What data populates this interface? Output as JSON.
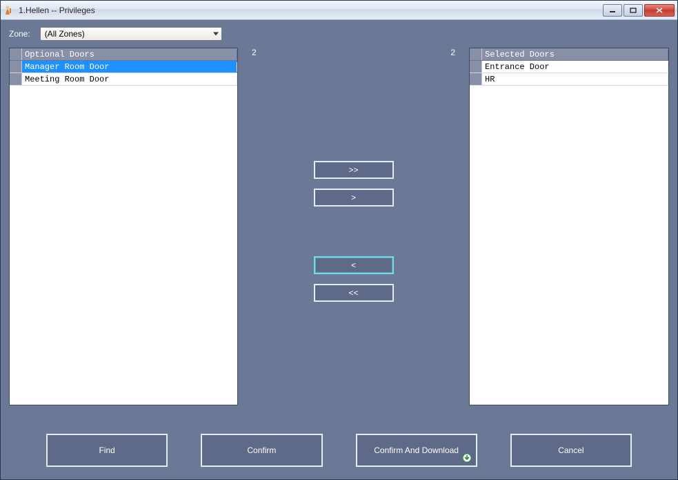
{
  "window": {
    "title": "1.Hellen -- Privileges"
  },
  "zone": {
    "label": "Zone:",
    "value": "(All Zones)"
  },
  "optional": {
    "header": "Optional Doors",
    "count": "2",
    "rows": [
      "Manager Room Door",
      "Meeting Room Door"
    ],
    "selected_index": 0
  },
  "selected": {
    "header": "Selected Doors",
    "count": "2",
    "rows": [
      "Entrance Door",
      "HR"
    ]
  },
  "transfer": {
    "add_all": ">>",
    "add_one": ">",
    "remove_one": "<",
    "remove_all": "<<"
  },
  "buttons": {
    "find": "Find",
    "confirm": "Confirm",
    "confirm_download": "Confirm And Download",
    "cancel": "Cancel"
  }
}
